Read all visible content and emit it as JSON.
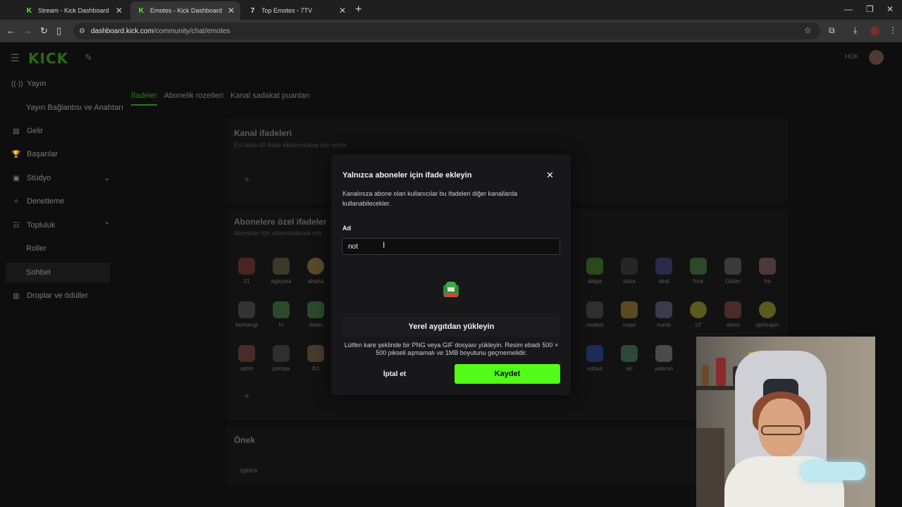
{
  "browser": {
    "tabs": [
      {
        "title": "Stream - Kick Dashboard",
        "icon": "kick-icon",
        "active": false
      },
      {
        "title": "Emotes - Kick Dashboard",
        "icon": "kick-icon",
        "active": true
      },
      {
        "title": "Top Emotes - 7TV",
        "icon": "7tv-icon",
        "active": false
      }
    ],
    "url_site": "dashboard.kick.com",
    "url_path": "/community/chat/emotes"
  },
  "app": {
    "logo": "KICK",
    "sidebar": [
      {
        "label": "Yayın",
        "icon": "broadcast-icon"
      },
      {
        "label": "Yayın Bağlantısı ve Anahtarı",
        "icon": ""
      },
      {
        "label": "Gelir",
        "icon": "revenue-icon"
      },
      {
        "label": "Başarılar",
        "icon": "trophy-icon"
      },
      {
        "label": "Stüdyo",
        "icon": "studio-icon"
      },
      {
        "label": "Denetleme",
        "icon": "moderation-icon"
      },
      {
        "label": "Topluluk",
        "icon": "community-icon"
      },
      {
        "label": "Roller",
        "icon": ""
      },
      {
        "label": "Sohbet",
        "icon": ""
      },
      {
        "label": "Droplar ve ödüller",
        "icon": "drops-icon"
      }
    ],
    "tabs": [
      "İfadeler",
      "Abonelik rozetleri",
      "Kanal sadakat puanları"
    ],
    "channel_emotes": {
      "title": "Kanal ifadeleri",
      "desc": "En fazla 60 ifade eklenmesine izin verilir"
    },
    "sub_emotes": {
      "title": "Abonelere özel ifadeler",
      "desc": "Aboneler için eklenebilecek ma",
      "row1_left": [
        "31",
        "agiryara",
        "ahaha"
      ],
      "row1_right": [
        "dalga",
        "dans",
        "deal",
        "fcuk",
        "Glider",
        "ha"
      ],
      "row2_left": [
        "herhangi",
        "hi",
        "hmm"
      ],
      "row2_right": [
        "nodeal",
        "nope",
        "numb",
        "o7",
        "olemi",
        "ophirajan"
      ],
      "row3_left": [
        "optm",
        "pompa",
        "rb1"
      ],
      "row3_right": [
        "vutuut",
        "wc",
        "yalarun"
      ]
    },
    "prefix": {
      "title": "Önek",
      "value": "ophira"
    }
  },
  "modal": {
    "title": "Yalnızca aboneler için ifade ekleyin",
    "subtitle": "Kanalınıza abone olan kullanıcılar bu ifadeleri diğer kanallarda kullanabilecekler.",
    "name_label": "Ad",
    "name_value": "not",
    "upload_label": "Yerel aygıtdan yükleyin",
    "upload_note": "Lütfen kare şeklinde bir PNG veya GIF dosyası yükleyin. Resim ebadı 500 × 500 pikseli aşmamalı ve 1MB boyutunu geçmemelidir.",
    "cancel_label": "İptal et",
    "save_label": "Kaydet",
    "accent": "#53fc18"
  }
}
